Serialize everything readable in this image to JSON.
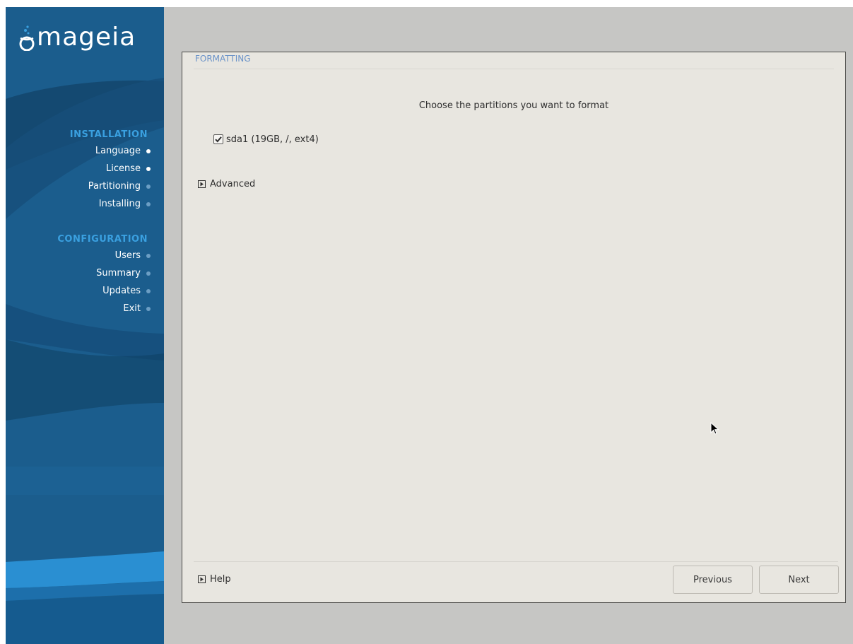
{
  "brand": {
    "name": "mageia"
  },
  "sidebar": {
    "installation_heading": "INSTALLATION",
    "installation_items": [
      {
        "label": "Language",
        "status": "done"
      },
      {
        "label": "License",
        "status": "done"
      },
      {
        "label": "Partitioning",
        "status": "pending"
      },
      {
        "label": "Installing",
        "status": "pending"
      }
    ],
    "configuration_heading": "CONFIGURATION",
    "configuration_items": [
      {
        "label": "Users",
        "status": "pending"
      },
      {
        "label": "Summary",
        "status": "pending"
      },
      {
        "label": "Updates",
        "status": "pending"
      },
      {
        "label": "Exit",
        "status": "pending"
      }
    ]
  },
  "main": {
    "section_title": "FORMATTING",
    "instruction": "Choose the partitions you want to format",
    "partition": {
      "label": "sda1 (19GB, /, ext4)",
      "checked": true
    },
    "advanced_label": "Advanced",
    "help_label": "Help"
  },
  "buttons": {
    "previous": "Previous",
    "next": "Next"
  },
  "colors": {
    "sidebar_bg": "#1b5d8d",
    "heading_accent": "#3aa0e0",
    "section_title": "#6b93c8",
    "panel_bg": "#e8e6e0"
  },
  "icons": {
    "check": "check-icon",
    "expander": "triangle-right-icon",
    "cursor": "mouse-pointer-icon"
  }
}
